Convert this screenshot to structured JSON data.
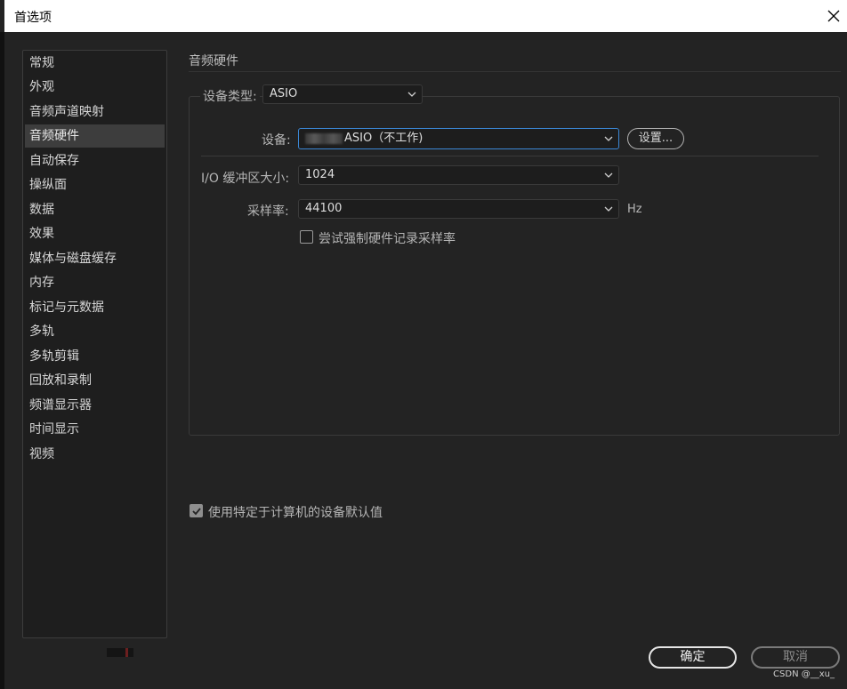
{
  "window": {
    "title": "首选项"
  },
  "sidebar": {
    "items": [
      {
        "label": "常规"
      },
      {
        "label": "外观"
      },
      {
        "label": "音频声道映射"
      },
      {
        "label": "音频硬件",
        "active": true
      },
      {
        "label": "自动保存"
      },
      {
        "label": "操纵面"
      },
      {
        "label": "数据"
      },
      {
        "label": "效果"
      },
      {
        "label": "媒体与磁盘缓存"
      },
      {
        "label": "内存"
      },
      {
        "label": "标记与元数据"
      },
      {
        "label": "多轨"
      },
      {
        "label": "多轨剪辑"
      },
      {
        "label": "回放和录制"
      },
      {
        "label": "频谱显示器"
      },
      {
        "label": "时间显示"
      },
      {
        "label": "视频"
      }
    ]
  },
  "panel": {
    "title": "音频硬件",
    "device_type_label": "设备类型:",
    "device_type_value": "ASIO",
    "device_label": "设备:",
    "device_value": "ASIO（不工作)",
    "settings_button": "设置...",
    "buffer_label": "I/O 缓冲区大小:",
    "buffer_value": "1024",
    "sample_rate_label": "采样率:",
    "sample_rate_value": "44100",
    "sample_rate_unit": "Hz",
    "force_rate_label": "尝试强制硬件记录采样率",
    "force_rate_checked": false,
    "machine_default_label": "使用特定于计算机的设备默认值",
    "machine_default_checked": true
  },
  "footer": {
    "ok_label": "确定",
    "cancel_label": "取消",
    "watermark": "CSDN @__xu_"
  },
  "colors": {
    "background": "#232323",
    "focus_border": "#3a86d4",
    "active_item": "#3d3d3d"
  }
}
